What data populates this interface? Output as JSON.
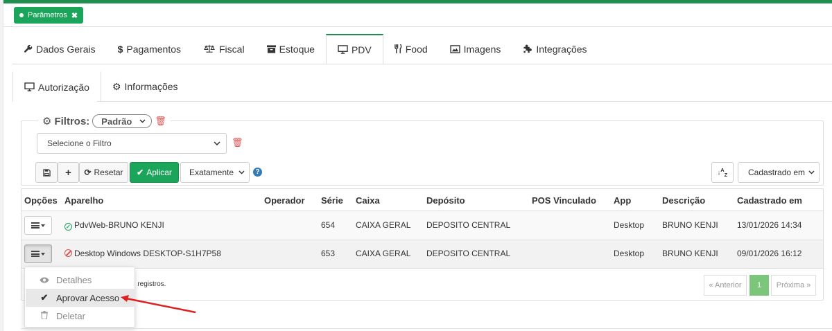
{
  "header": {
    "param_badge": "Parâmetros"
  },
  "tabs": [
    {
      "label": "Dados Gerais",
      "icon": "wrench-icon"
    },
    {
      "label": "Pagamentos",
      "icon": "dollar-icon"
    },
    {
      "label": "Fiscal",
      "icon": "balance-scale-icon"
    },
    {
      "label": "Estoque",
      "icon": "archive-icon"
    },
    {
      "label": "PDV",
      "icon": "desktop-icon",
      "active": true
    },
    {
      "label": "Food",
      "icon": "cutlery-icon"
    },
    {
      "label": "Imagens",
      "icon": "image-icon"
    },
    {
      "label": "Integrações",
      "icon": "puzzle-icon"
    }
  ],
  "subtabs": [
    {
      "label": "Autorização",
      "icon": "desktop-icon",
      "active": true
    },
    {
      "label": "Informações",
      "icon": "gear-icon"
    }
  ],
  "filters": {
    "title": "Filtros:",
    "preset": "Padrão",
    "select_placeholder": "Selecione o Filtro",
    "reset_label": "Resetar",
    "apply_label": "Aplicar",
    "match_mode": "Exatamente",
    "sort_by": "Cadastrado em"
  },
  "table": {
    "headers": [
      "Opções",
      "Aparelho",
      "Operador",
      "Série",
      "Caixa",
      "Depósito",
      "POS Vinculado",
      "App",
      "Descrição",
      "Cadastrado em"
    ],
    "rows": [
      {
        "status": "approved",
        "aparelho": "PdvWeb-BRUNO KENJI",
        "operador": "",
        "serie": "654",
        "caixa": "CAIXA GERAL",
        "deposito": "DEPOSITO CENTRAL",
        "pos": "",
        "app": "Desktop",
        "descricao": "BRUNO KENJI",
        "cadastrado": "13/01/2026 14:34"
      },
      {
        "status": "blocked",
        "aparelho": "Desktop Windows DESKTOP-S1H7P58",
        "operador": "",
        "serie": "653",
        "caixa": "CAIXA GERAL",
        "deposito": "DEPOSITO CENTRAL",
        "pos": "",
        "app": "Desktop",
        "descricao": "BRUNO KENJI",
        "cadastrado": "09/01/2026 16:12"
      }
    ],
    "footer_text": "2 registros.",
    "pager": {
      "prev": "« Anterior",
      "page": "1",
      "next": "Próxima »"
    }
  },
  "dropdown": {
    "items": [
      {
        "label": "Detalhes",
        "icon": "eye-icon"
      },
      {
        "label": "Aprovar Acesso",
        "icon": "check-icon",
        "highlighted": true
      },
      {
        "label": "Deletar",
        "icon": "trash-icon"
      }
    ]
  },
  "colors": {
    "brand": "#1e8f4e",
    "success": "#1aa55a",
    "danger": "#d9534f",
    "annotation_arrow": "#e02020"
  }
}
